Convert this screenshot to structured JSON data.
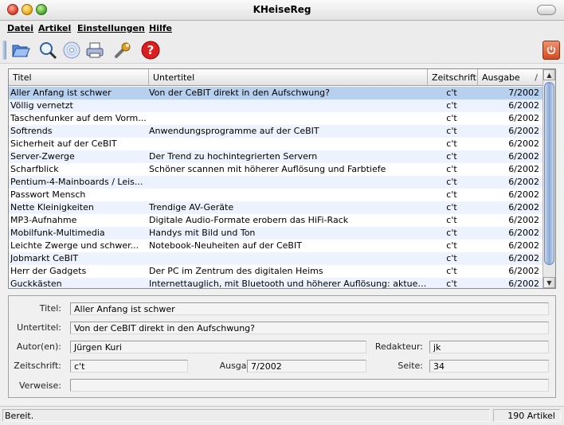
{
  "window": {
    "title": "KHeiseReg"
  },
  "menubar": {
    "items": [
      "Datei",
      "Artikel",
      "Einstellungen",
      "Hilfe"
    ]
  },
  "toolbar": {
    "icons": [
      "folder-open-icon",
      "search-magnifier-icon",
      "cd-rom-icon",
      "printer-icon",
      "wrench-settings-icon",
      "help-icon"
    ],
    "right_icon": "power-quit-icon"
  },
  "list": {
    "columns": [
      "Titel",
      "Untertitel",
      "Zeitschrift",
      "Ausgabe"
    ],
    "sort_indicator": "/",
    "selected_index": 0,
    "rows": [
      {
        "title": "Aller Anfang ist schwer",
        "subtitle": "Von der CeBIT direkt in den Aufschwung?",
        "magazine": "c't",
        "issue": "7/2002"
      },
      {
        "title": "Völlig vernetzt",
        "subtitle": "",
        "magazine": "c't",
        "issue": "6/2002"
      },
      {
        "title": "Taschenfunker auf dem Vorm...",
        "subtitle": "",
        "magazine": "c't",
        "issue": "6/2002"
      },
      {
        "title": "Softrends",
        "subtitle": "Anwendungsprogramme auf der CeBIT",
        "magazine": "c't",
        "issue": "6/2002"
      },
      {
        "title": "Sicherheit auf der CeBIT",
        "subtitle": "",
        "magazine": "c't",
        "issue": "6/2002"
      },
      {
        "title": "Server-Zwerge",
        "subtitle": "Der Trend zu hochintegrierten Servern",
        "magazine": "c't",
        "issue": "6/2002"
      },
      {
        "title": "Scharfblick",
        "subtitle": "Schöner scannen mit höherer Auflösung und Farbtiefe",
        "magazine": "c't",
        "issue": "6/2002"
      },
      {
        "title": "Pentium-4-Mainboards / Leis...",
        "subtitle": "",
        "magazine": "c't",
        "issue": "6/2002"
      },
      {
        "title": "Passwort Mensch",
        "subtitle": "",
        "magazine": "c't",
        "issue": "6/2002"
      },
      {
        "title": "Nette Kleinigkeiten",
        "subtitle": "Trendige AV-Geräte",
        "magazine": "c't",
        "issue": "6/2002"
      },
      {
        "title": "MP3-Aufnahme",
        "subtitle": "Digitale Audio-Formate erobern das HiFi-Rack",
        "magazine": "c't",
        "issue": "6/2002"
      },
      {
        "title": "Mobilfunk-Multimedia",
        "subtitle": "Handys mit Bild und Ton",
        "magazine": "c't",
        "issue": "6/2002"
      },
      {
        "title": "Leichte Zwerge und schwer...",
        "subtitle": "Notebook-Neuheiten auf der CeBIT",
        "magazine": "c't",
        "issue": "6/2002"
      },
      {
        "title": "Jobmarkt CeBIT",
        "subtitle": "",
        "magazine": "c't",
        "issue": "6/2002"
      },
      {
        "title": "Herr der Gadgets",
        "subtitle": "Der PC im Zentrum des digitalen Heims",
        "magazine": "c't",
        "issue": "6/2002"
      },
      {
        "title": "Guckkästen",
        "subtitle": "Internettauglich, mit Bluetooth und höherer Auflösung: aktuell...",
        "magazine": "c't",
        "issue": "6/2002"
      }
    ]
  },
  "details": {
    "title_label": "Titel:",
    "title_value": "Aller Anfang ist schwer",
    "subtitle_label": "Untertitel:",
    "subtitle_value": "Von der CeBIT direkt in den Aufschwung?",
    "author_label": "Autor(en):",
    "author_value": "Jürgen Kuri",
    "editor_label": "Redakteur:",
    "editor_value": "jk",
    "magazine_label": "Zeitschrift:",
    "magazine_value": "c't",
    "issue_label": "Ausgabe:",
    "issue_value": "7/2002",
    "page_label": "Seite:",
    "page_value": "34",
    "refs_label": "Verweise:",
    "refs_value": ""
  },
  "status": {
    "left": "Bereit.",
    "right": "190 Artikel"
  }
}
